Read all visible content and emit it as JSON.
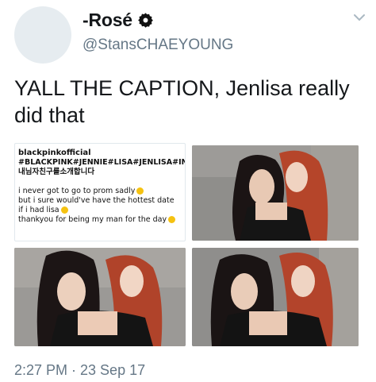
{
  "author": {
    "display_name": "-Rosé",
    "handle": "@StansCHAEYOUNG"
  },
  "tweet": {
    "text": "YALL THE CAPTION, Jenlisa really did that",
    "timestamp": "2:27 PM · 23 Sep 17"
  },
  "media": {
    "caption_card": {
      "username": "blackpinkofficial",
      "hashtags": "#BLACKPINK#JENNIE#LISA#JENLISA#INDAHOUSE#IFWEWENTTOPROM#MYHOTDATE#내님자친구를소개합니다",
      "line1": "i never got to go to prom sadly",
      "line2": "but i sure would've have the hottest date if i had lisa",
      "line3": "thankyou for being my man for the day"
    },
    "photos": [
      {
        "description": "photo-1"
      },
      {
        "description": "photo-2"
      },
      {
        "description": "photo-3"
      }
    ]
  },
  "icons": {
    "verified": "verified-badge-icon",
    "menu": "chevron-down-icon"
  },
  "colors": {
    "text": "#14171a",
    "secondary": "#657786",
    "avatar": "#e6ecf0"
  }
}
